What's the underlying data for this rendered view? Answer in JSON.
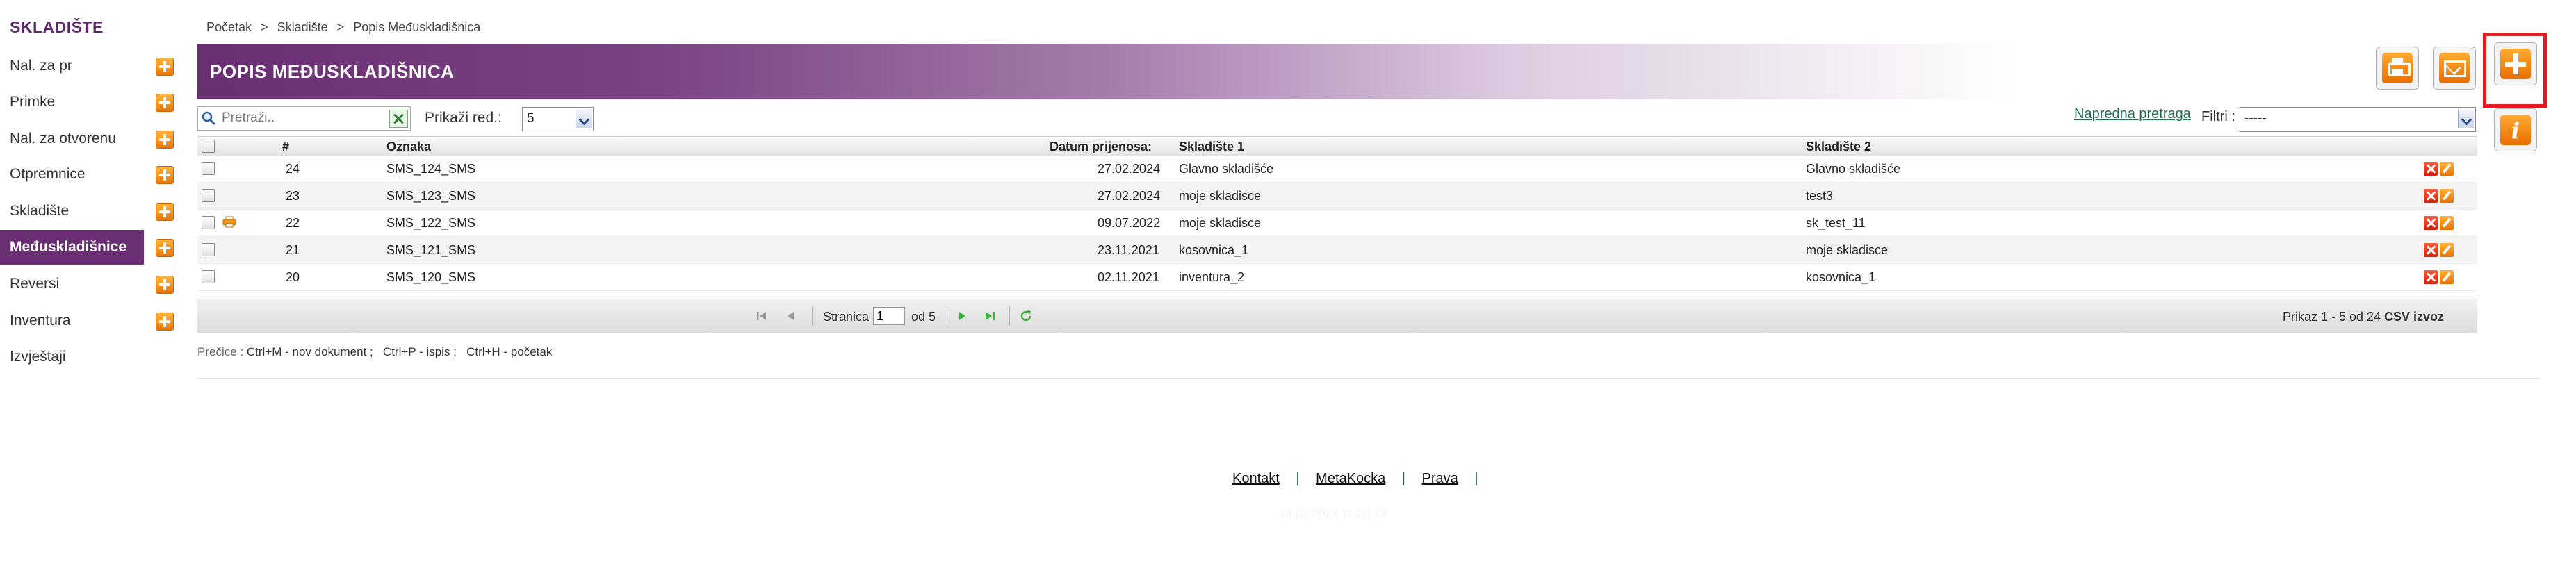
{
  "sidebar": {
    "title": "SKLADIŠTE",
    "items": [
      {
        "label": "Nal. za pr",
        "has_add": true,
        "active": false
      },
      {
        "label": "Primke",
        "has_add": true,
        "active": false
      },
      {
        "label": "Nal. za otvorenu",
        "has_add": true,
        "active": false
      },
      {
        "label": "Otpremnice",
        "has_add": true,
        "active": false
      },
      {
        "label": "Skladište",
        "has_add": true,
        "active": false
      },
      {
        "label": "Međuskladišnice",
        "has_add": true,
        "active": true
      },
      {
        "label": "Reversi",
        "has_add": true,
        "active": false
      },
      {
        "label": "Inventura",
        "has_add": true,
        "active": false
      },
      {
        "label": "Izvještaji",
        "has_add": false,
        "active": false
      }
    ]
  },
  "breadcrumb": [
    "Početak",
    ">",
    "Skladište",
    ">",
    "Popis Međuskladišnica"
  ],
  "header": {
    "title": "POPIS MEĐUSKLADIŠNICA"
  },
  "toolbar": {
    "search_placeholder": "Pretraži..",
    "rows_label": "Prikaži red.:",
    "rows_value": "5",
    "advanced_search": "Napredna pretraga",
    "filter_label": "Filtri :",
    "filter_value": "-----"
  },
  "actions": {
    "print_icon": "printer-icon",
    "email_icon": "envelope-icon",
    "add_icon": "plus-icon",
    "info_icon": "info-icon",
    "highlight_color": "#e8171f"
  },
  "table": {
    "columns": [
      "#",
      "Oznaka",
      "Datum prijenosa:",
      "Skladište 1",
      "Skladište 2"
    ],
    "rows": [
      {
        "num": "24",
        "oznaka": "SMS_124_SMS",
        "datum": "27.02.2024",
        "sk1": "Glavno skladišće",
        "sk2": "Glavno skladišće",
        "printed": false
      },
      {
        "num": "23",
        "oznaka": "SMS_123_SMS",
        "datum": "27.02.2024",
        "sk1": "moje skladisce",
        "sk2": "test3",
        "printed": false
      },
      {
        "num": "22",
        "oznaka": "SMS_122_SMS",
        "datum": "09.07.2022",
        "sk1": "moje skladisce",
        "sk2": "sk_test_11",
        "printed": true
      },
      {
        "num": "21",
        "oznaka": "SMS_121_SMS",
        "datum": "23.11.2021",
        "sk1": "kosovnica_1",
        "sk2": "moje skladisce",
        "printed": false
      },
      {
        "num": "20",
        "oznaka": "SMS_120_SMS",
        "datum": "02.11.2021",
        "sk1": "inventura_2",
        "sk2": "kosovnica_1",
        "printed": false
      }
    ]
  },
  "pager": {
    "page_label": "Stranica",
    "page_value": "1",
    "of_label": "od 5",
    "info": "Prikaz 1 - 5 od 24",
    "csv": "CSV izvoz"
  },
  "shortcuts": {
    "label": "Prečice :",
    "items": [
      "Ctrl+M - nov dokument ;",
      "Ctrl+P - ispis ;",
      "Ctrl+H - početak"
    ]
  },
  "footer": {
    "links": [
      "Kontakt",
      "MetaKocka",
      "Prava"
    ],
    "separator": "|",
    "timestamp": "14.03.2024 11:20:13"
  },
  "colors": {
    "brand": "#6a2f73",
    "accent": "#f08a12",
    "link": "#1c6b4e"
  }
}
